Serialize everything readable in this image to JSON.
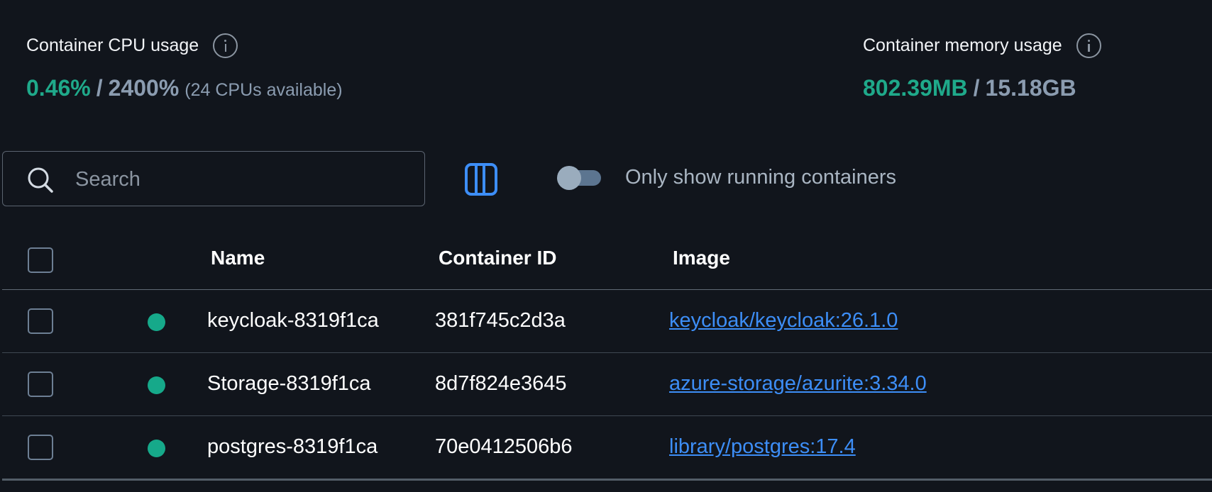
{
  "stats": {
    "cpu": {
      "label": "Container CPU usage",
      "used": "0.46%",
      "separator": "/",
      "total": "2400%",
      "note": "(24 CPUs available)"
    },
    "memory": {
      "label": "Container memory usage",
      "used": "802.39MB",
      "separator": "/",
      "total": "15.18GB"
    }
  },
  "toolbar": {
    "search_placeholder": "Search",
    "search_value": "",
    "toggle_label": "Only show running containers",
    "toggle_on": false
  },
  "table": {
    "headers": {
      "name": "Name",
      "container_id": "Container ID",
      "image": "Image"
    },
    "rows": [
      {
        "name": "keycloak-8319f1ca",
        "container_id": "381f745c2d3a",
        "image": "keycloak/keycloak:26.1.0",
        "status": "running"
      },
      {
        "name": "Storage-8319f1ca",
        "container_id": "8d7f824e3645",
        "image": "azure-storage/azurite:3.34.0",
        "status": "running"
      },
      {
        "name": "postgres-8319f1ca",
        "container_id": "70e0412506b6",
        "image": "library/postgres:17.4",
        "status": "running"
      }
    ]
  },
  "colors": {
    "background": "#11151c",
    "accent_green": "#1fa98a",
    "link_blue": "#3d8ef7",
    "muted": "#8b9cb0"
  },
  "icons": {
    "info": "info-circle-icon",
    "search": "magnifier-icon",
    "columns": "columns-icon",
    "status": "status-dot-icon"
  }
}
